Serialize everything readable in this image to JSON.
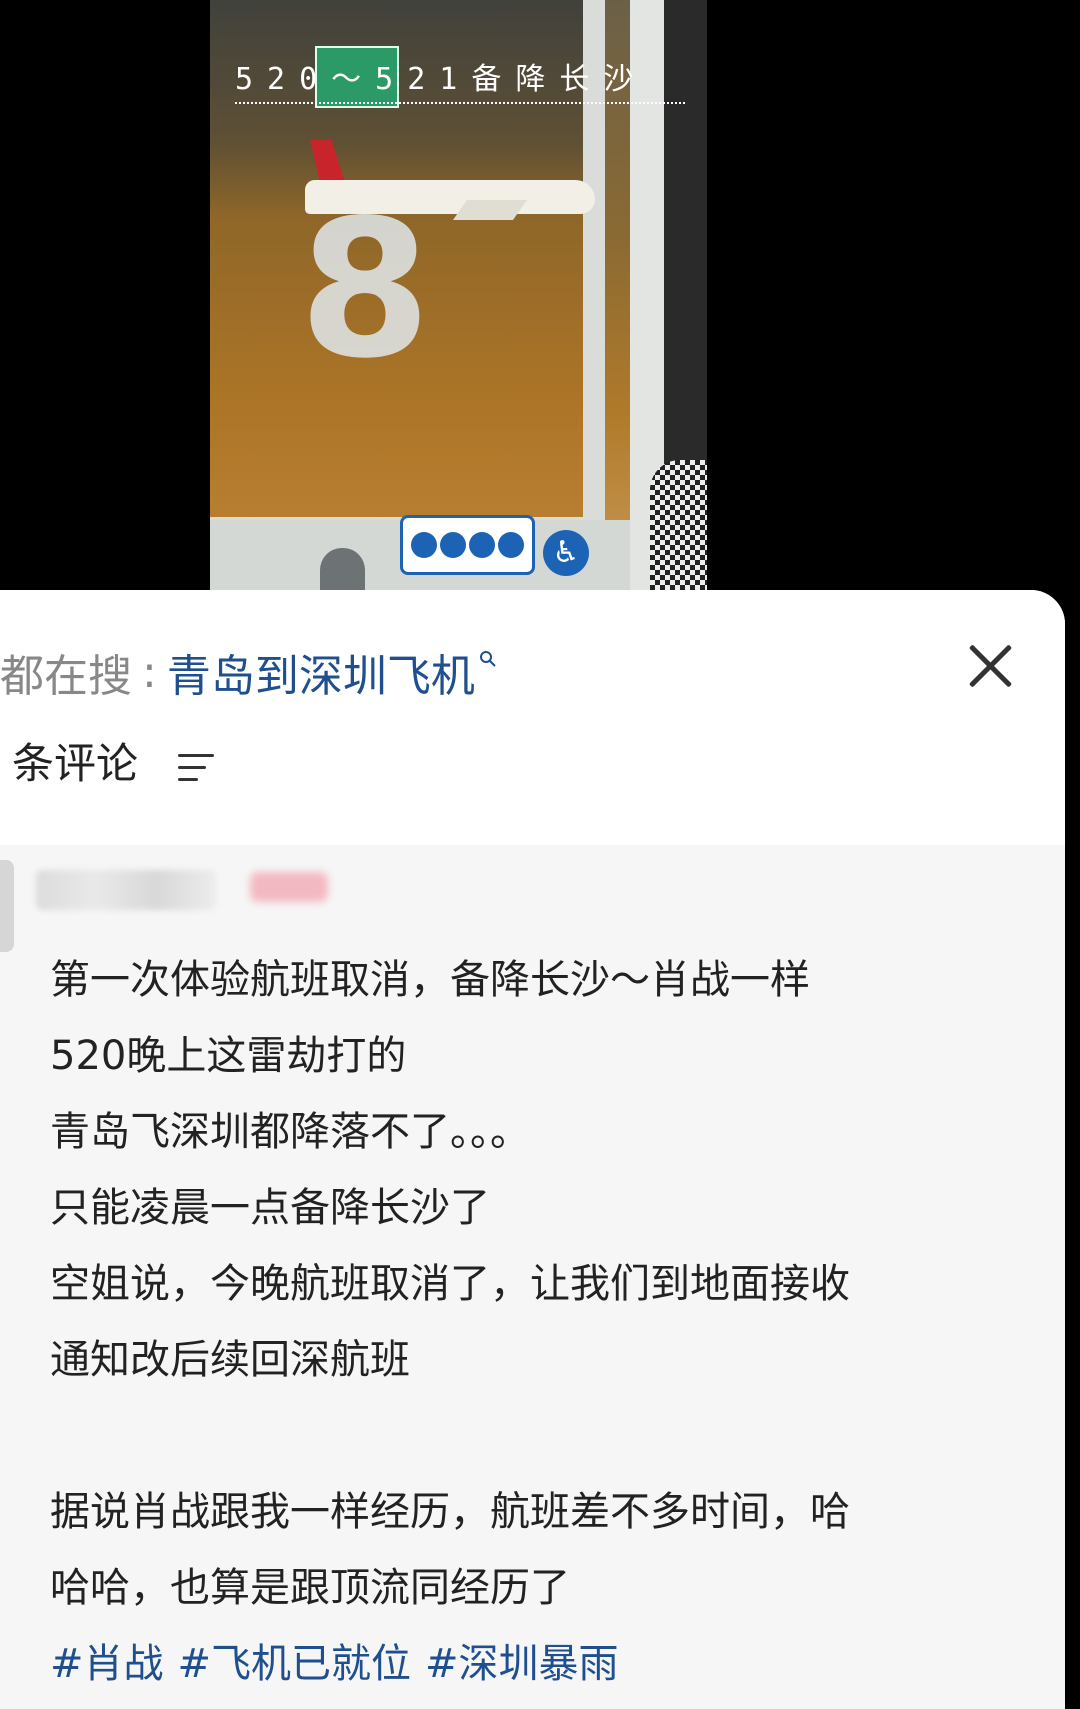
{
  "video": {
    "caption": "520～521备降长沙",
    "big_number": "8",
    "person_sign": "♿"
  },
  "search": {
    "prefix": "都在搜",
    "separator": ":",
    "term": "青岛到深圳飞机",
    "icon": "search-icon"
  },
  "comments_header": {
    "label": "条评论",
    "sort_icon": "sort-icon",
    "close_icon": "close-icon"
  },
  "comment": {
    "lines": [
      "第一次体验航班取消，备降长沙～肖战一样",
      "520晚上这雷劫打的",
      "青岛飞深圳都降落不了。。。",
      "只能凌晨一点备降长沙了",
      "空姐说，今晚航班取消了，让我们到地面接收",
      "通知改后续回深航班",
      "",
      "据说肖战跟我一样经历，航班差不多时间，哈",
      "哈哈，也算是跟顶流同经历了"
    ],
    "hashtags": [
      "#肖战",
      "#飞机已就位",
      "#深圳暴雨"
    ]
  },
  "colors": {
    "link": "#1f4f8f",
    "text": "#222222",
    "panel_bg": "#f6f6f6"
  }
}
